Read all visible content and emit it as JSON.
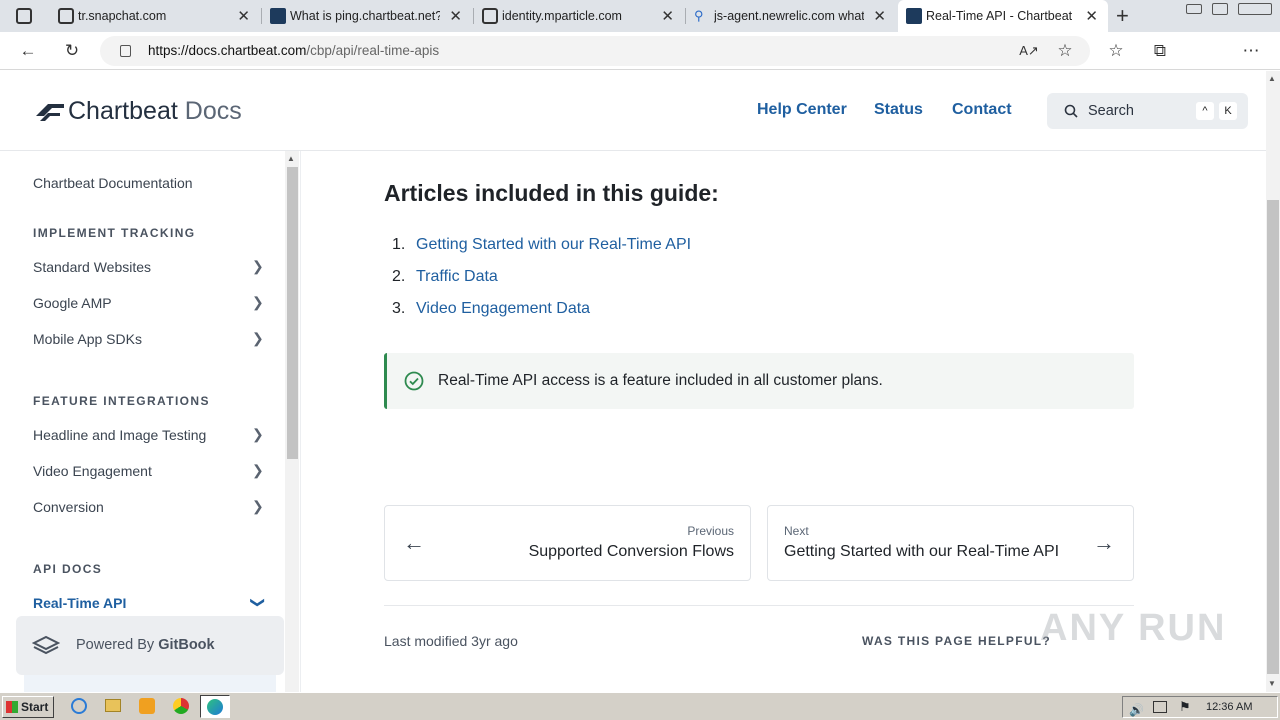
{
  "browser": {
    "tabs": [
      {
        "title": "tr.snapchat.com",
        "close": "✕"
      },
      {
        "title": "What is ping.chartbeat.net?",
        "close": "✕"
      },
      {
        "title": "identity.mparticle.com",
        "close": "✕"
      },
      {
        "title": "js-agent.newrelic.com what",
        "close": "✕"
      },
      {
        "title": "Real-Time API - Chartbeat D",
        "close": "✕"
      }
    ],
    "new_tab": "+",
    "url_host": "https://docs.chartbeat.com",
    "url_path": "/cbp/api/real-time-apis"
  },
  "header": {
    "logo_brand": "Chartbeat",
    "logo_docs": "Docs",
    "nav": [
      "Help Center",
      "Status",
      "Contact"
    ],
    "search_placeholder": "Search",
    "kbd_1": "^",
    "kbd_2": "K"
  },
  "sidebar": {
    "top_link": "Chartbeat Documentation",
    "section_1": "IMPLEMENT TRACKING",
    "items_1": [
      "Standard Websites",
      "Google AMP",
      "Mobile App SDKs"
    ],
    "section_2": "FEATURE INTEGRATIONS",
    "items_2": [
      "Headline and Image Testing",
      "Video Engagement",
      "Conversion"
    ],
    "section_3": "API DOCS",
    "active_item": "Real-Time API",
    "powered_prefix": "Powered By",
    "powered_brand": "GitBook"
  },
  "main": {
    "heading": "Articles included in this guide:",
    "list": [
      {
        "num": "1.",
        "label": "Getting Started with our Real-Time API"
      },
      {
        "num": "2.",
        "label": "Traffic Data"
      },
      {
        "num": "3.",
        "label": "Video Engagement Data"
      }
    ],
    "hint": "Real-Time API access is a feature included in all customer plans.",
    "prev_label": "Previous",
    "prev_title": "Supported Conversion Flows",
    "next_label": "Next",
    "next_title": "Getting Started with our Real-Time API",
    "last_modified": "Last modified 3yr ago",
    "helpful": "WAS THIS PAGE HELPFUL?"
  },
  "watermark": "ANY RUN",
  "taskbar": {
    "start": "Start",
    "clock": "12:36 AM"
  },
  "colors": {
    "link": "#1f5fa0",
    "hint_accent": "#2e8a4f"
  }
}
